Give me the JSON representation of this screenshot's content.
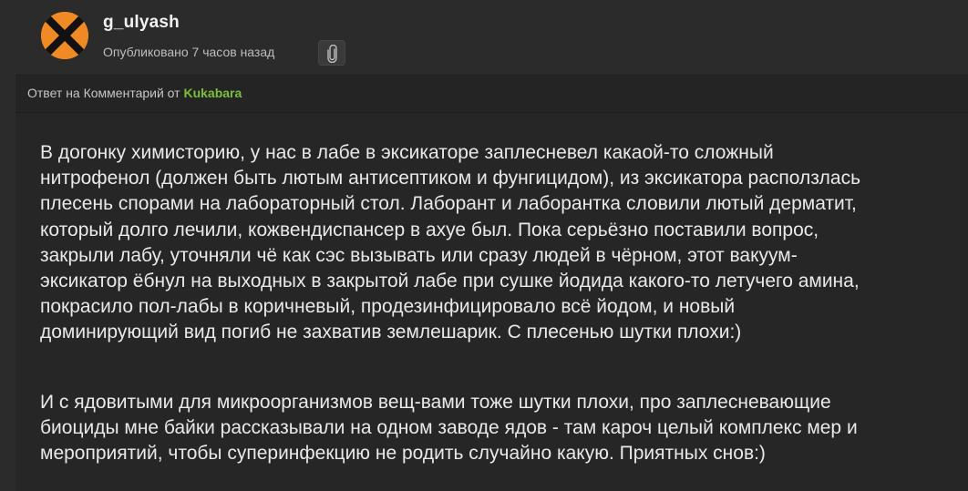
{
  "post": {
    "username": "g_ulyash",
    "published": "Опубликовано 7 часов назад"
  },
  "reply": {
    "prefix": "Ответ на Комментарий от",
    "author": "Kukabara"
  },
  "comment": {
    "paragraph1": [
      "В догонку химисторию, у нас в лабе в эксикаторе заплесневел какаой-то сложный",
      "нитрофенол (должен быть лютым антисептиком и фунгицидом), из эксикатора расползлась",
      "плесень спорами на лабораторный стол. Лаборант и лаборантка словили лютый дерматит,",
      "который долго лечили, кожвендиспансер в ахуе был. Пока серьёзно поставили вопрос,",
      "закрыли лабу, уточняли чё как сэс вызывать или сразу людей в чёрном, этот вакуум-",
      "эксикатор ёбнул на выходных в закрытой лабе при сушке йодида какого-то летучего амина,",
      "покрасило пол-лабы в коричневый, продезинфицировало всё йодом, и новый",
      "доминирующий вид погиб не захватив землешарик. С плесенью шутки плохи:)"
    ],
    "paragraph2": [
      "И с ядовитыми для микроорганизмов вещ-вами тоже шутки плохи, про заплесневающие",
      "биоциды мне байки рассказывали на одном заводе ядов - там кароч целый комплекс мер и",
      "мероприятий, чтобы суперинфекцию не родить случайно какую. Приятных снов:)"
    ]
  },
  "icons": {
    "avatar": "orange-circle-black-x-avatar",
    "attach": "paperclip-icon"
  },
  "colors": {
    "background": "#2b2b2b",
    "reply_bar": "#242424",
    "body": "#262626",
    "author_accent": "#7bbf3a",
    "avatar_orange": "#f08a24"
  }
}
